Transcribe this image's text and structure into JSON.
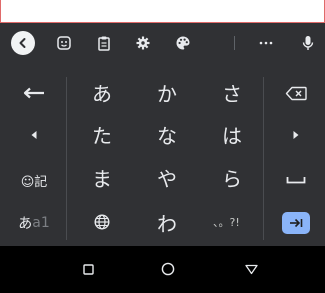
{
  "toolbar": {
    "icons": [
      "back-icon",
      "sticker-icon",
      "clipboard-icon",
      "settings-icon",
      "theme-icon",
      "more-icon",
      "microphone-icon"
    ]
  },
  "keyboard": {
    "left_column": {
      "undo": "undo-arrow-icon",
      "cursor_left": "cursor-left-icon",
      "emoji_symbol": "☺記",
      "input_mode": {
        "main": "あ",
        "sub": "a1"
      }
    },
    "kana_keys": [
      [
        "あ",
        "か",
        "さ"
      ],
      [
        "た",
        "な",
        "は"
      ],
      [
        "ま",
        "や",
        "ら"
      ],
      [
        "",
        "わ",
        ""
      ]
    ],
    "punctuation_key": "、。?!",
    "right_column": {
      "backspace": "backspace-icon",
      "cursor_right": "cursor-right-icon",
      "space": "space-icon",
      "enter": "tab-enter-icon"
    },
    "accent_color": "#8ab4f8"
  },
  "navbar": {
    "icons": [
      "recent-apps-icon",
      "home-icon",
      "back-triangle-icon"
    ]
  }
}
